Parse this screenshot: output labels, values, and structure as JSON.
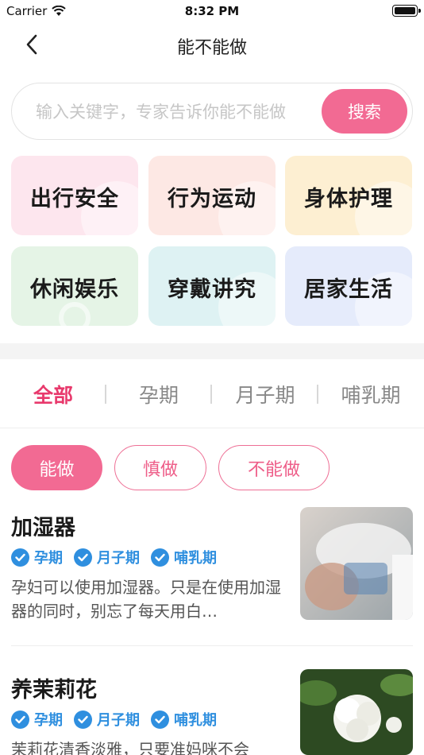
{
  "status_bar": {
    "carrier": "Carrier",
    "time": "8:32 PM"
  },
  "nav": {
    "title": "能不能做",
    "back_icon": "chevron-left-icon"
  },
  "search": {
    "placeholder": "输入关键字，专家告诉你能不能做",
    "value": "",
    "button": "搜索"
  },
  "categories": [
    {
      "label": "出行安全",
      "bg": "#fde6ee"
    },
    {
      "label": "行为运动",
      "bg": "#fde8e4"
    },
    {
      "label": "身体护理",
      "bg": "#fdefd2"
    },
    {
      "label": "休闲娱乐",
      "bg": "#e5f4e6"
    },
    {
      "label": "穿戴讲究",
      "bg": "#def2f3"
    },
    {
      "label": "居家生活",
      "bg": "#e5ebfb"
    }
  ],
  "tabs": [
    {
      "label": "全部",
      "active": true
    },
    {
      "label": "孕期",
      "active": false
    },
    {
      "label": "月子期",
      "active": false
    },
    {
      "label": "哺乳期",
      "active": false
    }
  ],
  "filters": [
    {
      "label": "能做",
      "active": true
    },
    {
      "label": "慎做",
      "active": false
    },
    {
      "label": "不能做",
      "active": false
    }
  ],
  "articles": [
    {
      "title": "加湿器",
      "tags": [
        "孕期",
        "月子期",
        "哺乳期"
      ],
      "desc": "孕妇可以使用加湿器。只是在使用加湿器的同时，别忘了每天用白…"
    },
    {
      "title": "养茉莉花",
      "tags": [
        "孕期",
        "月子期",
        "哺乳期"
      ],
      "desc": "茉莉花清香淡雅，只要准妈咪不会"
    }
  ],
  "colors": {
    "accent": "#f26a93",
    "tab_active": "#e8396c",
    "tag_blue": "#2f8fdf"
  }
}
